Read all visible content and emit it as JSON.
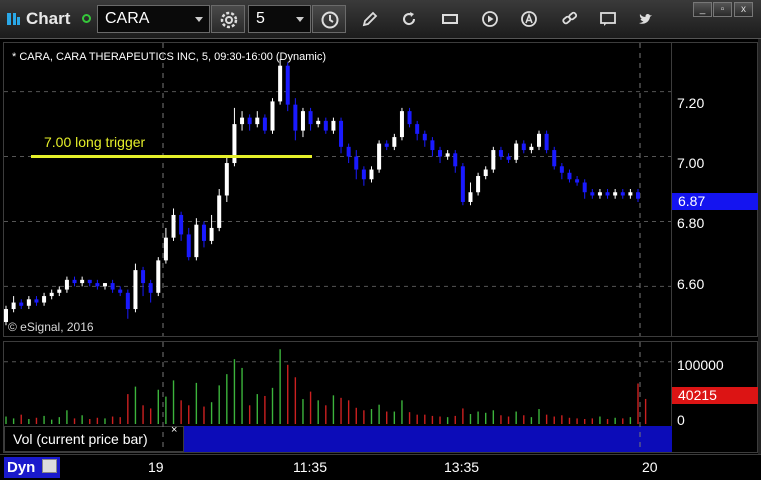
{
  "window": {
    "app_title": "Chart",
    "minimize_label": "_",
    "restore_label": "▫",
    "close_label": "x"
  },
  "toolbar": {
    "symbol": "CARA",
    "interval": "5",
    "icons": [
      "app-logo-icon",
      "link-icon",
      "settings-icon",
      "clock-icon",
      "pencil-icon",
      "refresh-icon",
      "get-icon",
      "play-icon",
      "alert-icon",
      "link-chain-icon",
      "chat-icon",
      "twitter-icon"
    ]
  },
  "chart": {
    "header": "* CARA, CARA THERAPEUTICS INC, 5, 09:30-16:00 (Dynamic)",
    "watermark": "© eSignal, 2016",
    "annotation": "7.00 long trigger",
    "price_ticks": [
      "7.20",
      "7.00",
      "6.80",
      "6.60"
    ],
    "last_price": "6.87",
    "volume_ticks": [
      "100000",
      "0"
    ],
    "last_volume": "40215",
    "volume_label": "Vol (current price bar)",
    "volume_close": "×",
    "time_labels": [
      "19",
      "11:35",
      "13:35",
      "20"
    ],
    "dyn_label": "Dyn",
    "colors": {
      "up": "#ffffff",
      "down": "#1a1aff",
      "trigger": "#e6f02a",
      "vol_up": "#3cb43c",
      "vol_down": "#cc2020",
      "price_tag": "#1414f0",
      "vol_tag": "#dc1414"
    }
  },
  "chart_data": {
    "type": "candlestick",
    "price_ylim": [
      6.45,
      7.35
    ],
    "volume_ylim": [
      0,
      130000
    ],
    "trigger_level": 7.0,
    "candles": [
      [
        6.49,
        6.53,
        6.48,
        6.54
      ],
      [
        6.53,
        6.55,
        6.52,
        6.57
      ],
      [
        6.55,
        6.54,
        6.53,
        6.56
      ],
      [
        6.54,
        6.56,
        6.53,
        6.57
      ],
      [
        6.56,
        6.55,
        6.54,
        6.57
      ],
      [
        6.55,
        6.57,
        6.54,
        6.58
      ],
      [
        6.57,
        6.58,
        6.56,
        6.59
      ],
      [
        6.58,
        6.59,
        6.57,
        6.6
      ],
      [
        6.59,
        6.62,
        6.58,
        6.63
      ],
      [
        6.62,
        6.61,
        6.6,
        6.63
      ],
      [
        6.61,
        6.62,
        6.6,
        6.63
      ],
      [
        6.62,
        6.61,
        6.6,
        6.62
      ],
      [
        6.61,
        6.6,
        6.59,
        6.62
      ],
      [
        6.6,
        6.61,
        6.59,
        6.61
      ],
      [
        6.61,
        6.59,
        6.58,
        6.62
      ],
      [
        6.59,
        6.58,
        6.57,
        6.6
      ],
      [
        6.58,
        6.53,
        6.5,
        6.59
      ],
      [
        6.53,
        6.65,
        6.52,
        6.67
      ],
      [
        6.65,
        6.61,
        6.57,
        6.66
      ],
      [
        6.61,
        6.58,
        6.55,
        6.62
      ],
      [
        6.58,
        6.68,
        6.57,
        6.69
      ],
      [
        6.68,
        6.75,
        6.67,
        6.78
      ],
      [
        6.75,
        6.82,
        6.74,
        6.84
      ],
      [
        6.82,
        6.76,
        6.74,
        6.83
      ],
      [
        6.76,
        6.69,
        6.68,
        6.78
      ],
      [
        6.69,
        6.79,
        6.68,
        6.81
      ],
      [
        6.79,
        6.74,
        6.72,
        6.8
      ],
      [
        6.74,
        6.78,
        6.73,
        6.82
      ],
      [
        6.78,
        6.88,
        6.77,
        6.9
      ],
      [
        6.88,
        6.98,
        6.86,
        7.0
      ],
      [
        6.98,
        7.1,
        6.97,
        7.15
      ],
      [
        7.1,
        7.12,
        7.08,
        7.14
      ],
      [
        7.12,
        7.1,
        7.08,
        7.13
      ],
      [
        7.1,
        7.12,
        7.09,
        7.14
      ],
      [
        7.12,
        7.08,
        7.07,
        7.13
      ],
      [
        7.08,
        7.17,
        7.07,
        7.18
      ],
      [
        7.17,
        7.28,
        7.16,
        7.3
      ],
      [
        7.28,
        7.16,
        7.14,
        7.29
      ],
      [
        7.16,
        7.08,
        7.05,
        7.18
      ],
      [
        7.08,
        7.14,
        7.06,
        7.15
      ],
      [
        7.14,
        7.1,
        7.08,
        7.15
      ],
      [
        7.1,
        7.11,
        7.09,
        7.12
      ],
      [
        7.11,
        7.08,
        7.07,
        7.12
      ],
      [
        7.08,
        7.11,
        7.07,
        7.12
      ],
      [
        7.11,
        7.03,
        7.01,
        7.12
      ],
      [
        7.03,
        7.0,
        6.98,
        7.04
      ],
      [
        7.0,
        6.96,
        6.93,
        7.02
      ],
      [
        6.96,
        6.93,
        6.91,
        6.97
      ],
      [
        6.93,
        6.96,
        6.92,
        6.97
      ],
      [
        6.96,
        7.04,
        6.95,
        7.05
      ],
      [
        7.04,
        7.03,
        7.02,
        7.05
      ],
      [
        7.03,
        7.06,
        7.02,
        7.07
      ],
      [
        7.06,
        7.14,
        7.05,
        7.15
      ],
      [
        7.14,
        7.1,
        7.09,
        7.15
      ],
      [
        7.1,
        7.07,
        7.05,
        7.11
      ],
      [
        7.07,
        7.05,
        7.03,
        7.08
      ],
      [
        7.05,
        7.02,
        7.0,
        7.06
      ],
      [
        7.02,
        7.0,
        6.98,
        7.03
      ],
      [
        7.0,
        7.01,
        6.99,
        7.02
      ],
      [
        7.01,
        6.97,
        6.95,
        7.02
      ],
      [
        6.97,
        6.86,
        6.85,
        6.98
      ],
      [
        6.86,
        6.89,
        6.85,
        6.92
      ],
      [
        6.89,
        6.94,
        6.88,
        6.95
      ],
      [
        6.94,
        6.96,
        6.93,
        6.97
      ],
      [
        6.96,
        7.02,
        6.95,
        7.03
      ],
      [
        7.02,
        7.0,
        6.99,
        7.03
      ],
      [
        7.0,
        6.99,
        6.98,
        7.01
      ],
      [
        6.99,
        7.04,
        6.98,
        7.05
      ],
      [
        7.04,
        7.02,
        7.01,
        7.05
      ],
      [
        7.02,
        7.03,
        7.01,
        7.04
      ],
      [
        7.03,
        7.07,
        7.02,
        7.08
      ],
      [
        7.07,
        7.02,
        7.01,
        7.08
      ],
      [
        7.02,
        6.97,
        6.96,
        7.03
      ],
      [
        6.97,
        6.95,
        6.93,
        6.98
      ],
      [
        6.95,
        6.93,
        6.92,
        6.96
      ],
      [
        6.93,
        6.92,
        6.91,
        6.94
      ],
      [
        6.92,
        6.89,
        6.87,
        6.93
      ],
      [
        6.89,
        6.88,
        6.87,
        6.9
      ],
      [
        6.88,
        6.89,
        6.87,
        6.9
      ],
      [
        6.89,
        6.88,
        6.87,
        6.9
      ],
      [
        6.88,
        6.89,
        6.87,
        6.9
      ],
      [
        6.89,
        6.88,
        6.87,
        6.9
      ],
      [
        6.88,
        6.89,
        6.87,
        6.9
      ],
      [
        6.89,
        6.87,
        6.86,
        6.9
      ]
    ],
    "volumes": [
      12000,
      9000,
      15000,
      8000,
      10000,
      13000,
      7000,
      11000,
      22000,
      9000,
      14000,
      8000,
      10000,
      9000,
      12000,
      11000,
      48000,
      60000,
      30000,
      25000,
      55000,
      44000,
      70000,
      38000,
      30000,
      66000,
      28000,
      35000,
      62000,
      80000,
      104000,
      90000,
      30000,
      48000,
      45000,
      58000,
      120000,
      95000,
      75000,
      40000,
      52000,
      38000,
      30000,
      46000,
      42000,
      38000,
      26000,
      22000,
      24000,
      31000,
      20000,
      20000,
      38000,
      19000,
      15000,
      15000,
      13000,
      12000,
      11000,
      13000,
      25000,
      16000,
      20000,
      18000,
      22000,
      14000,
      12000,
      20000,
      14000,
      11000,
      24000,
      15000,
      12000,
      14000,
      10000,
      9000,
      8000,
      9000,
      12000,
      8000,
      10000,
      9000,
      11000,
      65000,
      40215
    ]
  }
}
